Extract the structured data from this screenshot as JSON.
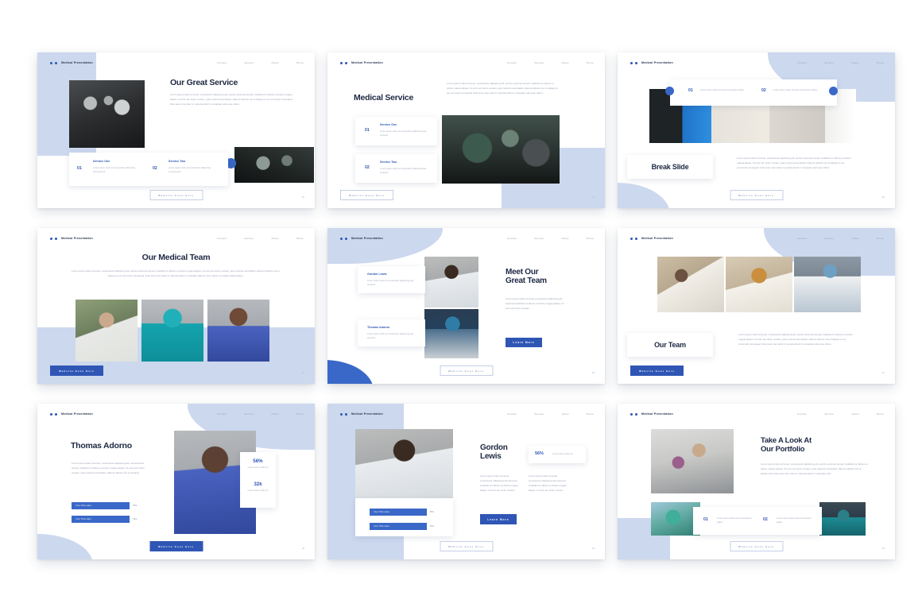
{
  "brand": {
    "logo_text": "Medical Presentation",
    "accent_blue": "#2f56b4",
    "accent_blue_light": "#ccd8ee",
    "blue_strong": "#3a68c8"
  },
  "nav": [
    "Contact",
    "Service",
    "About",
    "Home"
  ],
  "footer_label": "Website Goes Here",
  "lorem": {
    "short": "Lorem ipsum dolor sit consectetur adipiscing sed eiusmod",
    "short2": "Lorem ipsum dolor sit amet consectetur adipis",
    "one_line": "Lorem ipsum dolor sit",
    "medium": "Lorem ipsum dolor sit amet, consectetur adipiscing elit, sed do eiusmod tempor incididunt ut labore et dolore magna aliqua. Ut enim ad minim veniam, quis nostrud exercitation ullamco laboris nisi ut aliquip ex ea commodo consequat. Duis aute irure dolor in reprehenderit in voluptate velit esse cillum.",
    "long": "Lorem ipsum dolor sit amet, consectetur adipiscing elit, sed do eiusmod tempor incididunt ut labore et dolore magna aliqua. Ut enim ad minim veniam, quis nostrud exercitation ullamco laboris nisi ut aliquip ex ea commodo consequat. Duis aute irure dolor in reprehenderit in voluptate ullamco irure dolore eu fugiat nulla pariatur.",
    "col": "Lorem ipsum dolor sit amet consectetur adipiscing elit eiusmod incididunt ut labore et dolore magna aliqua. Ut enim ad minim veniam",
    "narrow": "Lorem ipsum dolor sit amet, consectetur adipiscing elit, sed eiusmod tempor incididunt ut labore et dolore magna aliqua. Ut enim ad minim veniam, quis nostrud exercitation ullamco laboris nisi consequat.",
    "stat": "Lorem ipsum dolor sit",
    "portfolio": "Lorem ipsum dolor sit amet, consectetur adipiscing elit, sed do eiusmod tempor incididunt ut labore et dolore magna aliqua. Ut enim ad minim veniam, quis nostrud exercitation ullamco laboris nisi ut aliquip commodo aute irure dolor in reprehenderit in voluptate velit."
  },
  "slides": [
    {
      "page": "16",
      "title": "Our Great Service",
      "items": [
        {
          "num": "01",
          "label": "Service One"
        },
        {
          "num": "02",
          "label": "Service Two"
        }
      ]
    },
    {
      "page": "17",
      "title": "Medical Service",
      "items": [
        {
          "num": "01",
          "label": "Service One"
        },
        {
          "num": "02",
          "label": "Service Two"
        }
      ]
    },
    {
      "page": "18",
      "title": "Break Slide",
      "items": [
        {
          "num": "01",
          "label": ""
        },
        {
          "num": "02",
          "label": ""
        }
      ]
    },
    {
      "page": "19",
      "title": "Our Medical Team"
    },
    {
      "page": "20",
      "title": "Meet Our\nGreat Team",
      "button": "Learn More",
      "people": [
        {
          "name": "Gordon Lewis"
        },
        {
          "name": "Thomas Adorno"
        }
      ]
    },
    {
      "page": "21",
      "title": "Our Team"
    },
    {
      "page": "22",
      "title": "Thomas Adorno",
      "stats": [
        {
          "value": "56%",
          "label": "Lorem ipsum dolor sit"
        },
        {
          "value": "32k",
          "label": "Lorem ipsum dolor sit"
        }
      ],
      "bars": [
        {
          "label": "Your Title Here",
          "pct": "85%",
          "width": 78
        },
        {
          "label": "Your Title Here",
          "pct": "69%",
          "width": 78
        }
      ]
    },
    {
      "page": "23",
      "title": "Gordon\nLewis",
      "button": "Learn More",
      "stat": {
        "value": "56%",
        "label": "Lorem ipsum dolor sit"
      },
      "bars": [
        {
          "label": "Your Title Here",
          "pct": "85%",
          "width": 78
        },
        {
          "label": "Your Title Here",
          "pct": "69%",
          "width": 78
        }
      ]
    },
    {
      "page": "24",
      "title": "Take A Look At\nOur Portfolio",
      "items": [
        {
          "num": "01",
          "label": "Lorem ipsum dolor amet consectetur adipis"
        },
        {
          "num": "02",
          "label": "Lorem ipsum dolor amet consectetur adipis"
        }
      ]
    }
  ]
}
